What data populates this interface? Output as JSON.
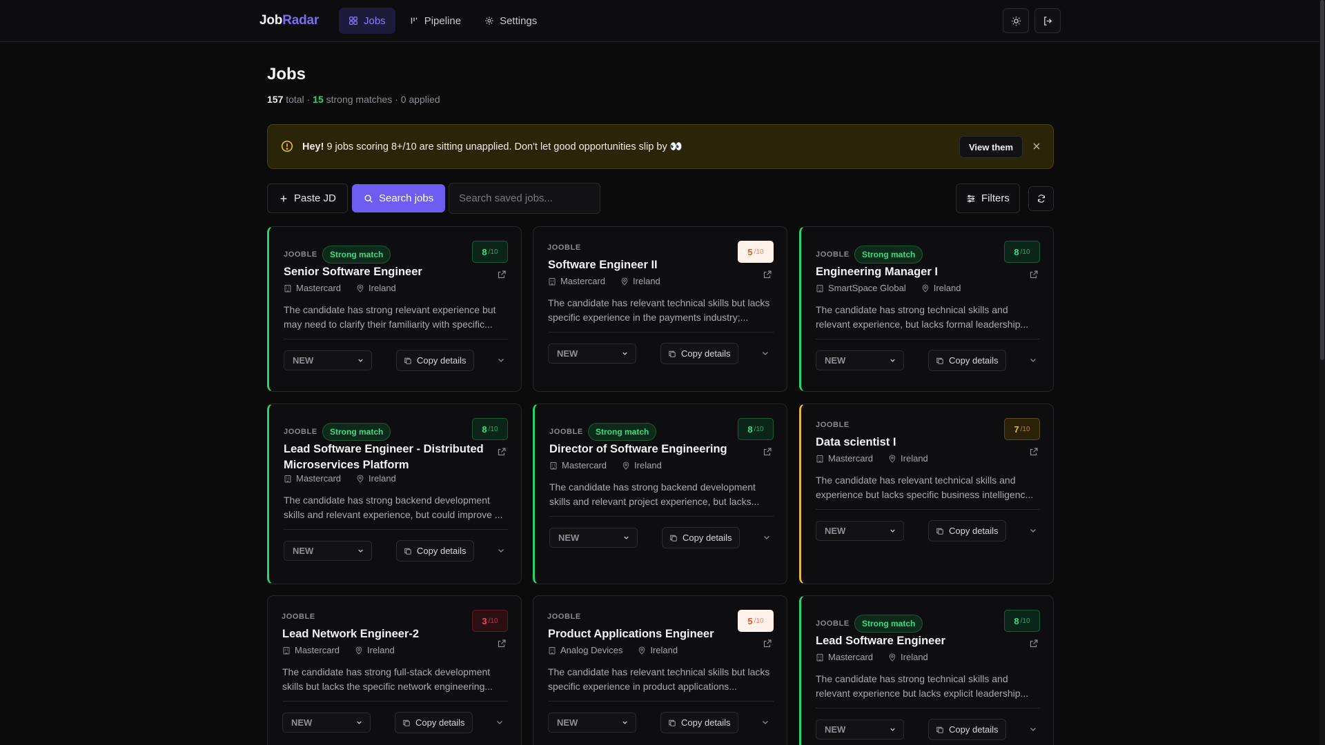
{
  "app": {
    "logo_main": "Job",
    "logo_accent": "Radar",
    "nav": [
      {
        "label": "Jobs",
        "icon": "grid-icon",
        "active": true
      },
      {
        "label": "Pipeline",
        "icon": "pipeline-icon",
        "active": false
      },
      {
        "label": "Settings",
        "icon": "gear-icon",
        "active": false
      }
    ]
  },
  "page": {
    "title": "Jobs",
    "stats": {
      "total": "157",
      "total_label": "total ·",
      "strong": "15",
      "strong_label": "strong matches · 0 applied"
    }
  },
  "banner": {
    "bold": "Hey!",
    "text": "9 jobs scoring 8+/10 are sitting unapplied. Don't let good opportunities slip by 👀",
    "action": "View them"
  },
  "toolbar": {
    "paste_label": "Paste JD",
    "search_label": "Search jobs",
    "search_placeholder": "Search saved jobs...",
    "filters_label": "Filters"
  },
  "cards": [
    {
      "source": "JOOBLE",
      "badge": "Strong match",
      "score": "8",
      "score_suffix": "/10",
      "title": "Senior Software Engineer",
      "company": "Mastercard",
      "location": "Ireland",
      "desc": "The candidate has strong relevant experience but may need to clarify their familiarity with specific...",
      "status": "NEW",
      "copy": "Copy details"
    },
    {
      "source": "JOOBLE",
      "badge": "",
      "score": "5",
      "score_suffix": "/10",
      "title": "Software Engineer II",
      "company": "Mastercard",
      "location": "Ireland",
      "desc": "The candidate has relevant technical skills but lacks specific experience in the payments industry;...",
      "status": "NEW",
      "copy": "Copy details"
    },
    {
      "source": "JOOBLE",
      "badge": "Strong match",
      "score": "8",
      "score_suffix": "/10",
      "title": "Engineering Manager I",
      "company": "SmartSpace Global",
      "location": "Ireland",
      "desc": "The candidate has strong technical skills and relevant experience, but lacks formal leadership...",
      "status": "NEW",
      "copy": "Copy details"
    },
    {
      "source": "JOOBLE",
      "badge": "Strong match",
      "score": "8",
      "score_suffix": "/10",
      "title": "Lead Software Engineer - Distributed Microservices Platform",
      "company": "Mastercard",
      "location": "Ireland",
      "desc": "The candidate has strong backend development skills and relevant experience, but could improve ...",
      "status": "NEW",
      "copy": "Copy details"
    },
    {
      "source": "JOOBLE",
      "badge": "Strong match",
      "score": "8",
      "score_suffix": "/10",
      "title": "Director of Software Engineering",
      "company": "Mastercard",
      "location": "Ireland",
      "desc": "The candidate has strong backend development skills and relevant project experience, but lacks...",
      "status": "NEW",
      "copy": "Copy details"
    },
    {
      "source": "JOOBLE",
      "badge": "",
      "score": "7",
      "score_suffix": "/10",
      "title": "Data scientist I",
      "company": "Mastercard",
      "location": "Ireland",
      "desc": "The candidate has relevant technical skills and experience but lacks specific business intelligenc...",
      "status": "NEW",
      "copy": "Copy details"
    },
    {
      "source": "JOOBLE",
      "badge": "",
      "score": "3",
      "score_suffix": "/10",
      "title": "Lead Network Engineer-2",
      "company": "Mastercard",
      "location": "Ireland",
      "desc": "The candidate has strong full-stack development skills but lacks the specific network engineering...",
      "status": "NEW",
      "copy": "Copy details"
    },
    {
      "source": "JOOBLE",
      "badge": "",
      "score": "5",
      "score_suffix": "/10",
      "title": "Product Applications Engineer",
      "company": "Analog Devices",
      "location": "Ireland",
      "desc": "The candidate has relevant technical skills but lacks specific experience in product applications...",
      "status": "NEW",
      "copy": "Copy details"
    },
    {
      "source": "JOOBLE",
      "badge": "Strong match",
      "score": "8",
      "score_suffix": "/10",
      "title": "Lead Software Engineer",
      "company": "Mastercard",
      "location": "Ireland",
      "desc": "The candidate has strong technical skills and relevant experience but lacks explicit leadership...",
      "status": "NEW",
      "copy": "Copy details"
    }
  ],
  "colors": {
    "accent": "#7c6cf6",
    "strong": "#3ddc84",
    "medium": "#e3b73a",
    "low": "#ef4b5b",
    "mid_orange": "#e2582b"
  }
}
